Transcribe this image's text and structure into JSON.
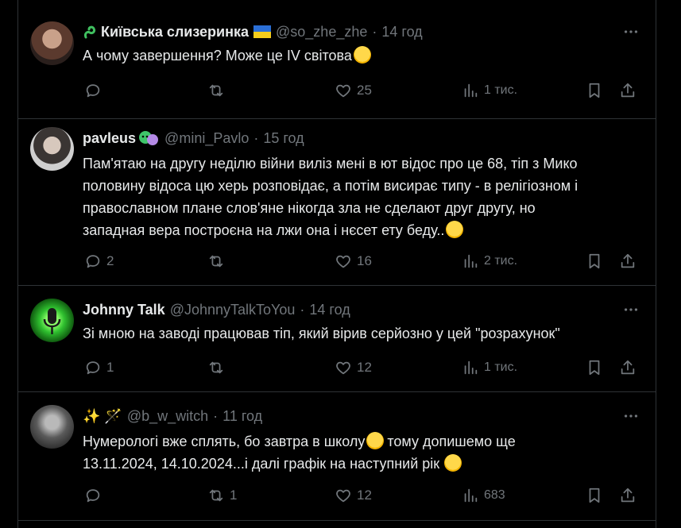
{
  "posts": [
    {
      "name": "Київська слизеринка",
      "handle": "@so_zhe_zhe",
      "dot": "·",
      "time": "14 год",
      "lines": [
        "А чому завершення?  Може це IV світова"
      ],
      "actions": {
        "reply": "",
        "repost": "",
        "like": "25",
        "views": "1 тис."
      }
    },
    {
      "name": "pavleus",
      "handle": "@mini_Pavlo",
      "dot": "·",
      "time": "15 год",
      "lines": [
        "Пам'ятаю на другу неділю війни виліз мені в ют відос про це 68, тіп з Мико",
        "половину відоса цю херь розповідає, а потім висирає типу - в релігіозном і",
        "православном плане слов'яне нікогда зла не сделают друг другу, но",
        "западная вера построєна на лжи она і нєсет ету беду.."
      ],
      "actions": {
        "reply": "2",
        "repost": "",
        "like": "16",
        "views": "2 тис."
      }
    },
    {
      "name": "Johnny Talk",
      "handle": "@JohnnyTalkToYou",
      "dot": "·",
      "time": "14 год",
      "lines": [
        "Зі мною на заводі працював тіп, який вірив серйозно у цей \"розрахунок\""
      ],
      "actions": {
        "reply": "1",
        "repost": "",
        "like": "12",
        "views": "1 тис."
      }
    },
    {
      "name": "✨ 🪄",
      "handle": "@b_w_witch",
      "dot": "·",
      "time": "11 год",
      "lines": [
        "Нумерологі вже сплять, бо завтра в школу",
        "тому допишемо ще",
        "13.11.2024, 14.10.2024...і далі графік на наступний рік"
      ],
      "actions": {
        "reply": "",
        "repost": "1",
        "like": "12",
        "views": "683"
      }
    }
  ],
  "colors": {
    "background": "#000000",
    "text": "#e7e9ea",
    "muted": "#71767b",
    "border": "#2f3336"
  }
}
